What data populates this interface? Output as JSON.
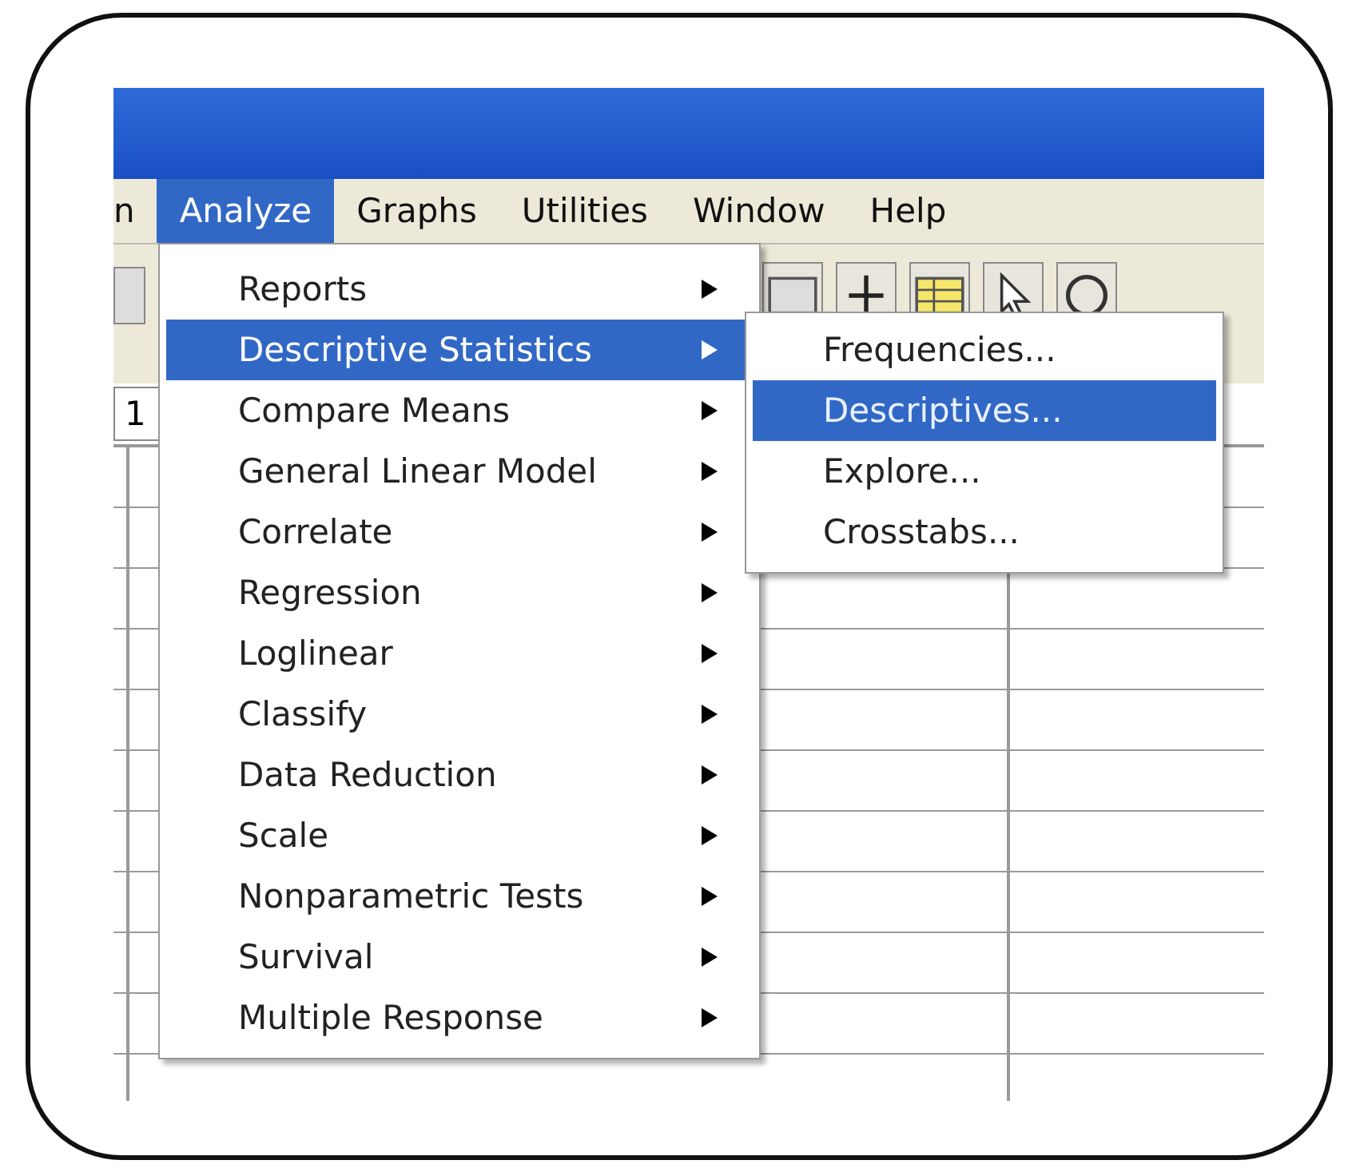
{
  "menu_bar": [
    {
      "label": "n",
      "selected": false
    },
    {
      "label": "Analyze",
      "selected": true
    },
    {
      "label": "Graphs",
      "selected": false
    },
    {
      "label": "Utilities",
      "selected": false
    },
    {
      "label": "Window",
      "selected": false
    },
    {
      "label": "Help",
      "selected": false
    }
  ],
  "cell_value": "1",
  "analyze_menu": [
    {
      "label": "Reports",
      "selected": false,
      "has_submenu": true
    },
    {
      "label": "Descriptive Statistics",
      "selected": true,
      "has_submenu": true
    },
    {
      "label": "Compare Means",
      "selected": false,
      "has_submenu": true
    },
    {
      "label": "General Linear Model",
      "selected": false,
      "has_submenu": true
    },
    {
      "label": "Correlate",
      "selected": false,
      "has_submenu": true
    },
    {
      "label": "Regression",
      "selected": false,
      "has_submenu": true
    },
    {
      "label": "Loglinear",
      "selected": false,
      "has_submenu": true
    },
    {
      "label": "Classify",
      "selected": false,
      "has_submenu": true
    },
    {
      "label": "Data Reduction",
      "selected": false,
      "has_submenu": true
    },
    {
      "label": "Scale",
      "selected": false,
      "has_submenu": true
    },
    {
      "label": "Nonparametric Tests",
      "selected": false,
      "has_submenu": true
    },
    {
      "label": "Survival",
      "selected": false,
      "has_submenu": true
    },
    {
      "label": "Multiple Response",
      "selected": false,
      "has_submenu": true
    }
  ],
  "submenu": [
    {
      "label": "Frequencies...",
      "selected": false
    },
    {
      "label": "Descriptives...",
      "selected": true
    },
    {
      "label": "Explore...",
      "selected": false
    },
    {
      "label": "Crosstabs...",
      "selected": false
    }
  ]
}
